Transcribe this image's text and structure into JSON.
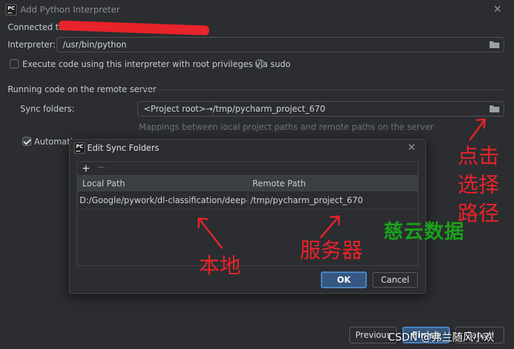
{
  "window": {
    "title": "Add Python Interpreter",
    "logo_text": "PC"
  },
  "main": {
    "connected_label": "Connected to",
    "interpreter_label": "Interpreter:",
    "interpreter_value": "/usr/bin/python",
    "sudo_checkbox_label": "Execute code using this interpreter with root privileges via sudo",
    "sudo_checked": false,
    "section_title": "Running code on the remote server",
    "sync_folders_label": "Sync folders:",
    "sync_folders_value": "<Project root>→/tmp/pycharm_project_670",
    "sync_hint": "Mappings between local project paths and remote paths on the server",
    "auto_upload_label": "Automatic",
    "auto_upload_checked": true
  },
  "dialog": {
    "title": "Edit Sync Folders",
    "logo_text": "PC",
    "add_label": "+",
    "remove_label": "−",
    "columns": [
      "Local Path",
      "Remote Path"
    ],
    "rows": [
      {
        "local": "D:/Google/pywork/dl-classification/deep-lea...",
        "remote": "/tmp/pycharm_project_670"
      }
    ],
    "ok_label": "OK",
    "cancel_label": "Cancel"
  },
  "footer": {
    "previous_label": "Previous",
    "finish_label": "Finish",
    "cancel_label": "Cancel"
  },
  "annotations": {
    "click_select_path": [
      "点击",
      "选择",
      "路径"
    ],
    "local": "本地",
    "server": "服务器",
    "colors": {
      "annotation": "#e8232a",
      "watermark": "#1aa11a"
    }
  },
  "watermarks": {
    "brand": "慈云数据",
    "csdn": "CSDN @弗兰随风小欢"
  }
}
